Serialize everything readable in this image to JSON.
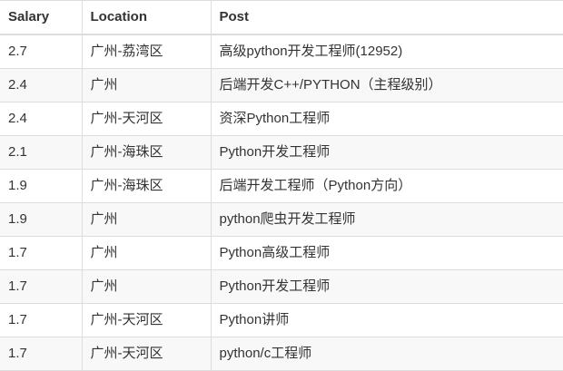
{
  "table": {
    "headers": [
      "Salary",
      "Location",
      "Post"
    ],
    "rows": [
      [
        "2.7",
        "广州-荔湾区",
        "高级python开发工程师(12952)"
      ],
      [
        "2.4",
        "广州",
        "后端开发C++/PYTHON（主程级别）"
      ],
      [
        "2.4",
        "广州-天河区",
        "资深Python工程师"
      ],
      [
        "2.1",
        "广州-海珠区",
        "Python开发工程师"
      ],
      [
        "1.9",
        "广州-海珠区",
        "后端开发工程师（Python方向）"
      ],
      [
        "1.9",
        "广州",
        "python爬虫开发工程师"
      ],
      [
        "1.7",
        "广州",
        "Python高级工程师"
      ],
      [
        "1.7",
        "广州",
        "Python开发工程师"
      ],
      [
        "1.7",
        "广州-天河区",
        "Python讲师"
      ],
      [
        "1.7",
        "广州-天河区",
        "python/c工程师"
      ]
    ]
  }
}
